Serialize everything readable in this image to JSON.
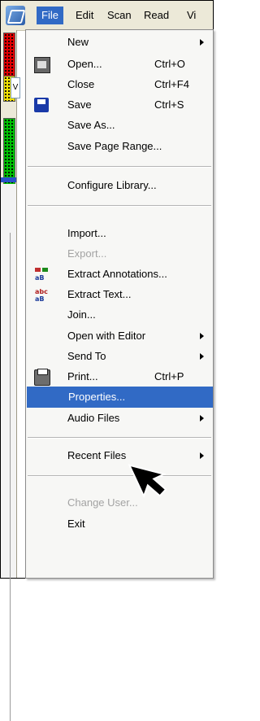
{
  "menubar": {
    "items": [
      "File",
      "Edit",
      "Scan",
      "Read",
      "Vi"
    ]
  },
  "left_strip": {
    "combo_text": "V"
  },
  "file_menu": {
    "items": [
      {
        "label": "New",
        "submenu": true
      },
      {
        "label": "Open...",
        "shortcut": "Ctrl+O",
        "icon": "open-icon"
      },
      {
        "label": "Close",
        "shortcut": "Ctrl+F4"
      },
      {
        "label": "Save",
        "shortcut": "Ctrl+S",
        "icon": "save-icon"
      },
      {
        "label": "Save As..."
      },
      {
        "label": "Save Page Range..."
      },
      {
        "label": "Configure Library..."
      },
      {
        "label": "Import..."
      },
      {
        "label": "Export...",
        "disabled": true
      },
      {
        "label": "Extract Annotations...",
        "icon": "extract-annotations-icon"
      },
      {
        "label": "Extract Text...",
        "icon": "extract-text-icon"
      },
      {
        "label": "Join..."
      },
      {
        "label": "Open with Editor",
        "submenu": true
      },
      {
        "label": "Send To",
        "submenu": true
      },
      {
        "label": "Print...",
        "shortcut": "Ctrl+P",
        "icon": "print-icon"
      },
      {
        "label": "Properties...",
        "highlighted": true
      },
      {
        "label": "Audio Files",
        "submenu": true
      },
      {
        "label": "Recent Files",
        "submenu": true
      },
      {
        "label": "Change User...",
        "disabled": true
      },
      {
        "label": "Exit"
      }
    ]
  },
  "colors": {
    "highlight": "#316ac5",
    "menubar_bg": "#ece9d8",
    "disabled_text": "#a3a3a3"
  }
}
